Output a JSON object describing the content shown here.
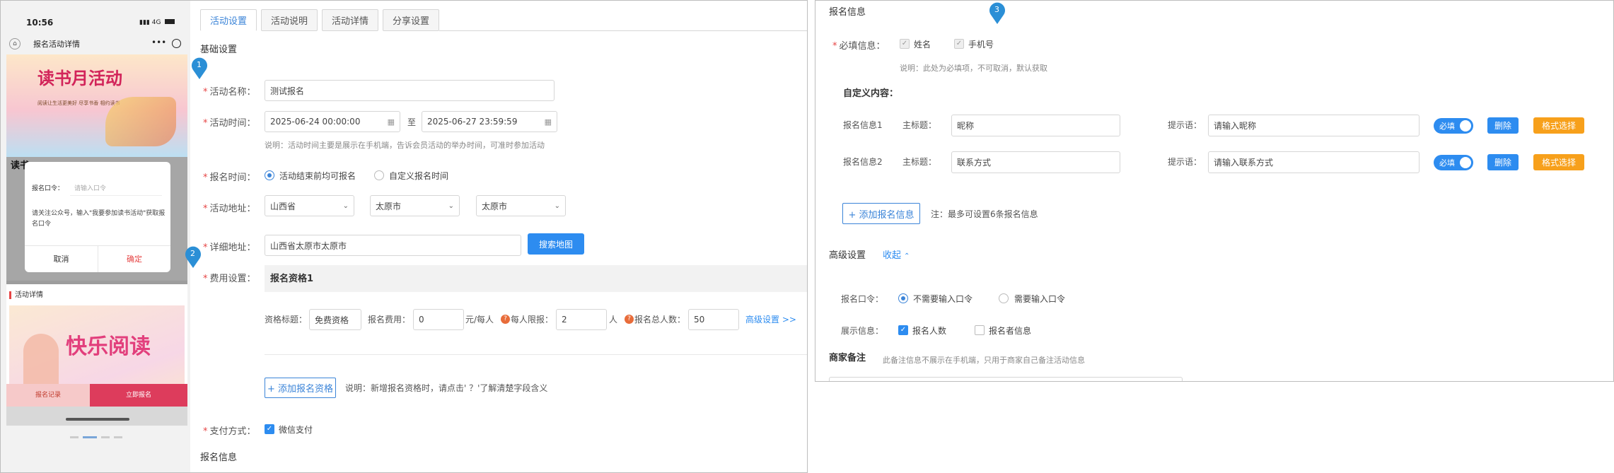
{
  "phone": {
    "time": "10:56",
    "signal": "4G",
    "title": "报名活动详情",
    "banner_title": "读书月活动",
    "banner_sub": "阅读让生活更美好 尽享书香 相约读书",
    "body_lines": [
      "读书"
    ],
    "dialog": {
      "label": "报名口令：",
      "placeholder": "请输入口令",
      "message": "请关注公众号，输入\"我要参加读书活动\"获取报名口令",
      "cancel": "取消",
      "confirm": "确定"
    },
    "section_label": "活动详情",
    "poster_text": "快乐阅读",
    "bottom_left": "报名记录",
    "bottom_right": "立即报名"
  },
  "tabs": [
    "活动设置",
    "活动说明",
    "活动详情",
    "分享设置"
  ],
  "basic": {
    "title": "基础设置",
    "name_label": "活动名称：",
    "name_value": "测试报名",
    "time_label": "活动时间：",
    "start": "2025-06-24 00:00:00",
    "to": "至",
    "end": "2025-06-27 23:59:59",
    "time_note": "说明：活动时间主要是展示在手机端，告诉会员活动的举办时间，可准时参加活动",
    "signup_label": "报名时间：",
    "signup_opt1": "活动结束前均可报名",
    "signup_opt2": "自定义报名时间",
    "addr_label": "活动地址：",
    "province": "山西省",
    "city": "太原市",
    "district": "太原市",
    "detail_label": "详细地址：",
    "detail_value": "山西省太原市太原市",
    "search_map": "搜索地图",
    "fee_label": "费用设置：",
    "qual_title": "报名资格1",
    "qual_name_label": "资格标题：",
    "qual_name": "免费资格",
    "fee_amount_label": "报名费用：",
    "fee_amount": "0",
    "fee_unit": "元/每人",
    "limit_label": "每人限报：",
    "limit_value": "2",
    "limit_unit": "人",
    "total_label": "报名总人数：",
    "total_value": "50",
    "advanced_link": "高级设置 >>",
    "add_qual": "+ 添加报名资格",
    "add_qual_note": "说明：新增报名资格时，请点击' ？'了解清楚字段含义",
    "pay_label": "支付方式：",
    "pay_value": "微信支付",
    "bottom_title": "报名信息"
  },
  "pins": [
    "1",
    "2",
    "3"
  ],
  "signup_info": {
    "title": "报名信息",
    "required_label": "必填信息：",
    "req_name": "姓名",
    "req_phone": "手机号",
    "req_note": "说明：此处为必填项，不可取消，默认获取",
    "custom_title": "自定义内容：",
    "rows": [
      {
        "label": "报名信息1",
        "main_label": "主标题：",
        "main_value": "昵称",
        "hint_label": "提示语：",
        "hint_value": "请输入昵称",
        "toggle": "必填",
        "delete": "删除",
        "format": "格式选择"
      },
      {
        "label": "报名信息2",
        "main_label": "主标题：",
        "main_value": "联系方式",
        "hint_label": "提示语：",
        "hint_value": "请输入联系方式",
        "toggle": "必填",
        "delete": "删除",
        "format": "格式选择"
      }
    ],
    "add_btn": "+ 添加报名信息",
    "add_note": "注：最多可设置6条报名信息"
  },
  "advanced": {
    "title": "高级设置",
    "collapse": "收起",
    "pwd_label": "报名口令：",
    "pwd_opt1": "不需要输入口令",
    "pwd_opt2": "需要输入口令",
    "show_label": "展示信息：",
    "show_opt1": "报名人数",
    "show_opt2": "报名者信息"
  },
  "merchant": {
    "title": "商家备注",
    "note": "此备注信息不展示在手机端，只用于商家自己备注活动信息"
  },
  "colors": {
    "accent": "#2d8cf0",
    "required": "#e64545",
    "orange": "#f7a01b",
    "pin": "#2b8fd6"
  }
}
